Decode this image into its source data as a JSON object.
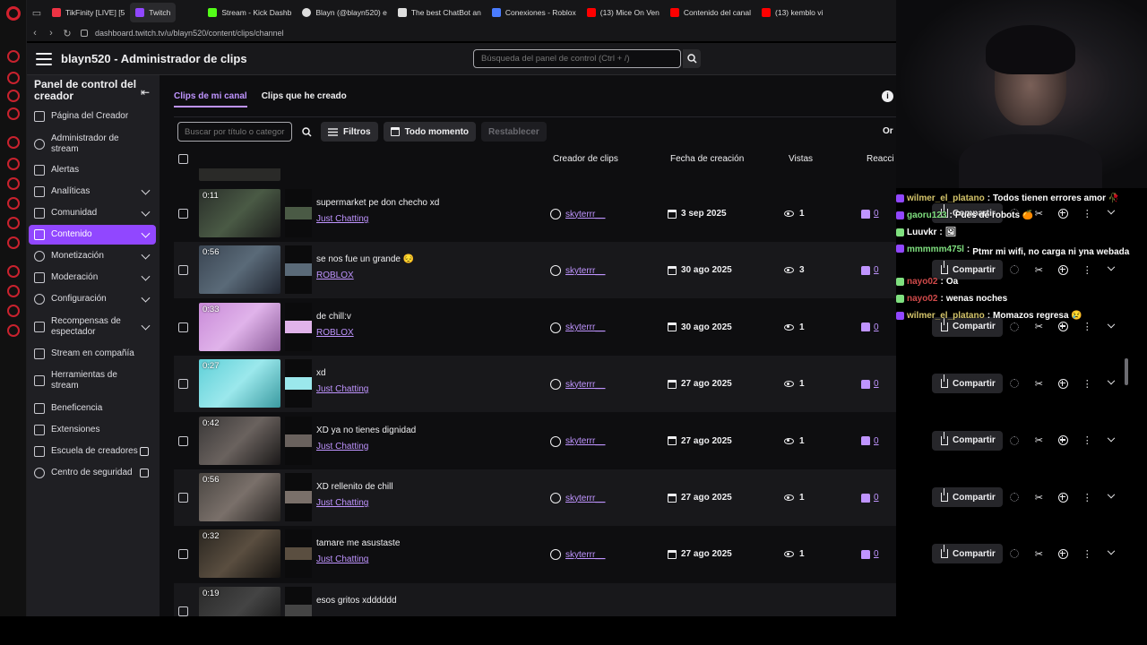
{
  "browser": {
    "tabs": [
      {
        "label": "TikFinity [LIVE] [5",
        "color": "#e34"
      },
      {
        "label": "Twitch",
        "color": "#9147ff"
      },
      {
        "label": "Stream - Kick Dashb",
        "color": "#53fc18"
      },
      {
        "label": "Blayn (@blayn520) e",
        "color": "#ddd"
      },
      {
        "label": "The best ChatBot an",
        "color": "#ddd"
      },
      {
        "label": "Conexiones - Roblox",
        "color": "#4a7cff"
      },
      {
        "label": "(13) Mice On Ven",
        "color": "#f00"
      },
      {
        "label": "Contenido del canal",
        "color": "#f00"
      },
      {
        "label": "(13) kemblo vi",
        "color": "#f00"
      }
    ],
    "url": "dashboard.twitch.tv/u/blayn520/content/clips/channel"
  },
  "topnav": {
    "title": "blayn520 - Administrador de clips",
    "search_placeholder": "Búsqueda del panel de control (Ctrl + /)"
  },
  "sidebar": {
    "header": "Panel de control del creador",
    "items": [
      {
        "label": "Página del Creador",
        "has_chevron": false
      },
      {
        "label": "Administrador de stream",
        "has_chevron": false
      },
      {
        "label": "Alertas",
        "has_chevron": false
      },
      {
        "label": "Analíticas",
        "has_chevron": true
      },
      {
        "label": "Comunidad",
        "has_chevron": true
      },
      {
        "label": "Contenido",
        "has_chevron": true,
        "active": true
      },
      {
        "label": "Monetización",
        "has_chevron": true
      },
      {
        "label": "Moderación",
        "has_chevron": true
      },
      {
        "label": "Configuración",
        "has_chevron": true
      },
      {
        "label": "Recompensas de espectador",
        "has_chevron": true
      },
      {
        "label": "Stream en compañía",
        "has_chevron": false
      },
      {
        "label": "Herramientas de stream",
        "has_chevron": false
      },
      {
        "label": "Beneficencia",
        "has_chevron": false
      },
      {
        "label": "Extensiones",
        "has_chevron": false
      },
      {
        "label": "Escuela de creadores",
        "external": true
      },
      {
        "label": "Centro de seguridad",
        "external": true
      }
    ]
  },
  "main": {
    "tabs": [
      "Clips de mi canal",
      "Clips que he creado"
    ],
    "filter_placeholder": "Buscar por título o categoría",
    "filters_label": "Filtros",
    "time_label": "Todo momento",
    "reset_label": "Restablecer",
    "order_label": "Or",
    "columns": {
      "creator": "Creador de clips",
      "date": "Fecha de creación",
      "views": "Vistas",
      "reactions": "Reacci"
    },
    "share_label": "Compartir",
    "clips": [
      {
        "duration": "0:11",
        "title": "supermarket pe don checho xd",
        "category": "Just Chatting",
        "creator": "skyterrr__",
        "date": "3 sep 2025",
        "views": "1",
        "likes": "0",
        "thumb": [
          "#2a2f2a",
          "#4a5a45",
          "#1a1a1a"
        ]
      },
      {
        "duration": "0:56",
        "title": "se nos fue un grande 😔",
        "category": "ROBLOX",
        "creator": "skyterrr__",
        "date": "30 ago 2025",
        "views": "3",
        "likes": "0",
        "thumb": [
          "#3a4552",
          "#5a6a78",
          "#202530"
        ]
      },
      {
        "duration": "0:33",
        "title": "de chill:v",
        "category": "ROBLOX",
        "creator": "skyterrr__",
        "date": "30 ago 2025",
        "views": "1",
        "likes": "0",
        "thumb": [
          "#c98ad8",
          "#e0b3ea",
          "#8a5b98"
        ]
      },
      {
        "duration": "0:27",
        "title": "xd",
        "category": "Just Chatting",
        "creator": "skyterrr__",
        "date": "27 ago 2025",
        "views": "1",
        "likes": "0",
        "thumb": [
          "#5fd0d8",
          "#9be8ec",
          "#3a9aa0"
        ]
      },
      {
        "duration": "0:42",
        "title": "XD ya no tienes dignidad",
        "category": "Just Chatting",
        "creator": "skyterrr__",
        "date": "27 ago 2025",
        "views": "1",
        "likes": "0",
        "thumb": [
          "#3a3838",
          "#6a625e",
          "#1a1818"
        ]
      },
      {
        "duration": "0:56",
        "title": "XD rellenito de chill",
        "category": "Just Chatting",
        "creator": "skyterrr__",
        "date": "27 ago 2025",
        "views": "1",
        "likes": "0",
        "thumb": [
          "#4a4642",
          "#7a706a",
          "#252220"
        ]
      },
      {
        "duration": "0:32",
        "title": "tamare me asustaste",
        "category": "Just Chatting",
        "creator": "skyterrr__",
        "date": "27 ago 2025",
        "views": "1",
        "likes": "0",
        "thumb": [
          "#2a2620",
          "#5a4e40",
          "#141210"
        ]
      },
      {
        "duration": "0:19",
        "title": "esos gritos xdddddd",
        "category": "",
        "creator": "",
        "date": "",
        "views": "",
        "likes": "",
        "thumb": [
          "#2a2a2a",
          "#444",
          "#111"
        ]
      }
    ]
  },
  "chat": [
    {
      "user": "wilmer_el_platano",
      "user_color": "#d4c46a",
      "msg": "Todos tienen errores amor 🥀",
      "badge": "#9147ff"
    },
    {
      "user": "gaoru123",
      "user_color": "#7fe07f",
      "msg": "Pues de robots 🍊",
      "badge": "#9147ff"
    },
    {
      "user": "Luuvkr",
      "user_color": "#fff",
      "msg": "🖼",
      "badge": "#7fe07f"
    },
    {
      "user": "mmmmm475l",
      "user_color": "#7fe07f",
      "msg": "Ptmr mi wifi, no carga ni yna webada",
      "badge": "#9147ff"
    },
    {
      "user": "nayo02",
      "user_color": "#d04a4a",
      "msg": "Oa",
      "badge": "#7fe07f"
    },
    {
      "user": "nayo02",
      "user_color": "#d04a4a",
      "msg": "wenas noches",
      "badge": "#7fe07f"
    },
    {
      "user": "wilmer_el_platano",
      "user_color": "#d4c46a",
      "msg": "Momazos regresa 😢",
      "badge": "#9147ff"
    }
  ]
}
